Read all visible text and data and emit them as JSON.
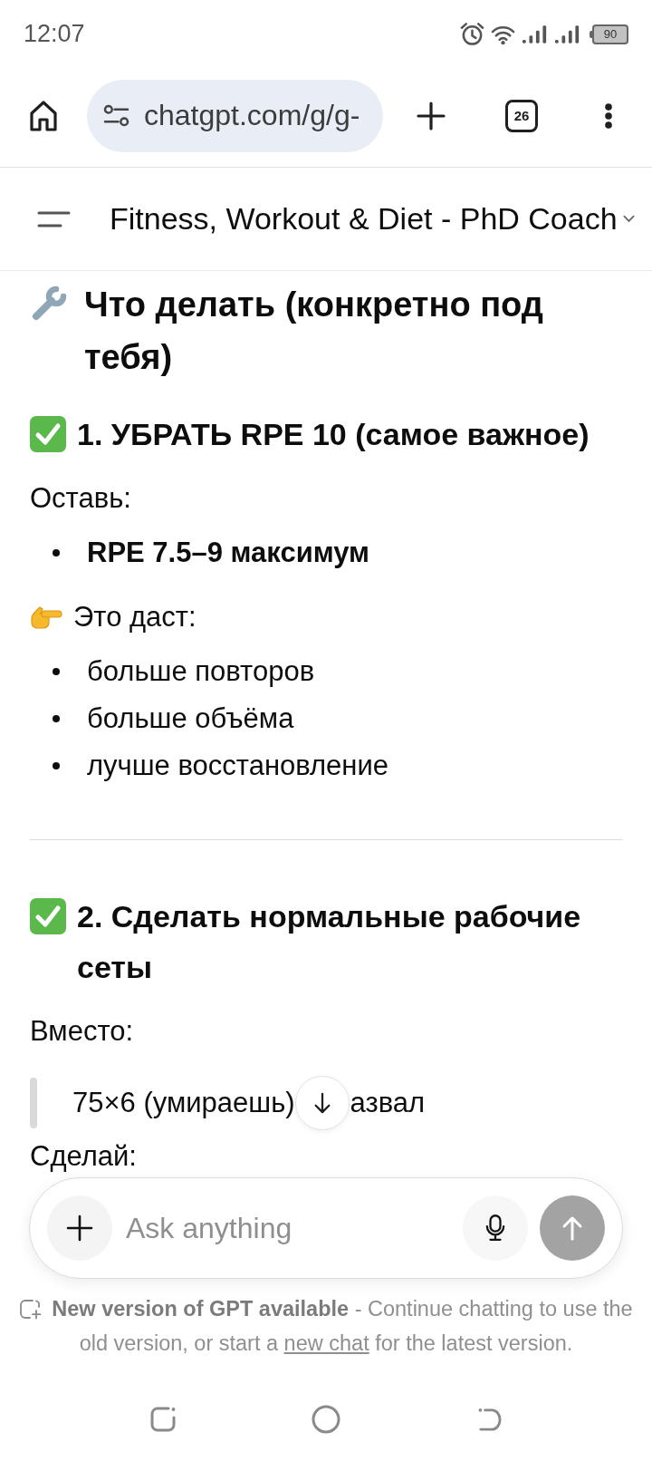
{
  "status_bar": {
    "time": "12:07",
    "battery": "90"
  },
  "browser_bar": {
    "url": "chatgpt.com/g/g-",
    "tab_count": "26"
  },
  "chat_header": {
    "title": "Fitness, Workout & Diet - PhD Coach"
  },
  "message": {
    "blocks": [
      {
        "kind": "title",
        "text": "Что делать (конкретно под тебя)"
      },
      {
        "kind": "step",
        "text": "1. УБРАТЬ RPE 10 (самое важное)"
      },
      {
        "kind": "paragraph",
        "text": "Оставь:"
      },
      {
        "kind": "bullets",
        "items": [
          {
            "text": "RPE 7.5–9 максимум",
            "bold": true
          }
        ]
      },
      {
        "kind": "pointer",
        "text": "Это даст:"
      },
      {
        "kind": "bullets",
        "items": [
          {
            "text": "больше повторов",
            "bold": false
          },
          {
            "text": "больше объёма",
            "bold": false
          },
          {
            "text": "лучше восстановление",
            "bold": false
          }
        ]
      },
      {
        "kind": "rule"
      },
      {
        "kind": "step",
        "text": "2. Сделать нормальные рабочие сеты"
      },
      {
        "kind": "paragraph",
        "text": "Вместо:"
      },
      {
        "kind": "quote",
        "parts": [
          "75×6 (умираешь)",
          "азвал"
        ]
      },
      {
        "kind": "paragraph",
        "text": "Сделай:"
      }
    ]
  },
  "composer": {
    "placeholder": "Ask anything"
  },
  "notice": {
    "text": "**New version of GPT available** - Continue chatting to use the old version, or start a",
    "link": "new chat",
    "text_after": "for the latest version."
  }
}
